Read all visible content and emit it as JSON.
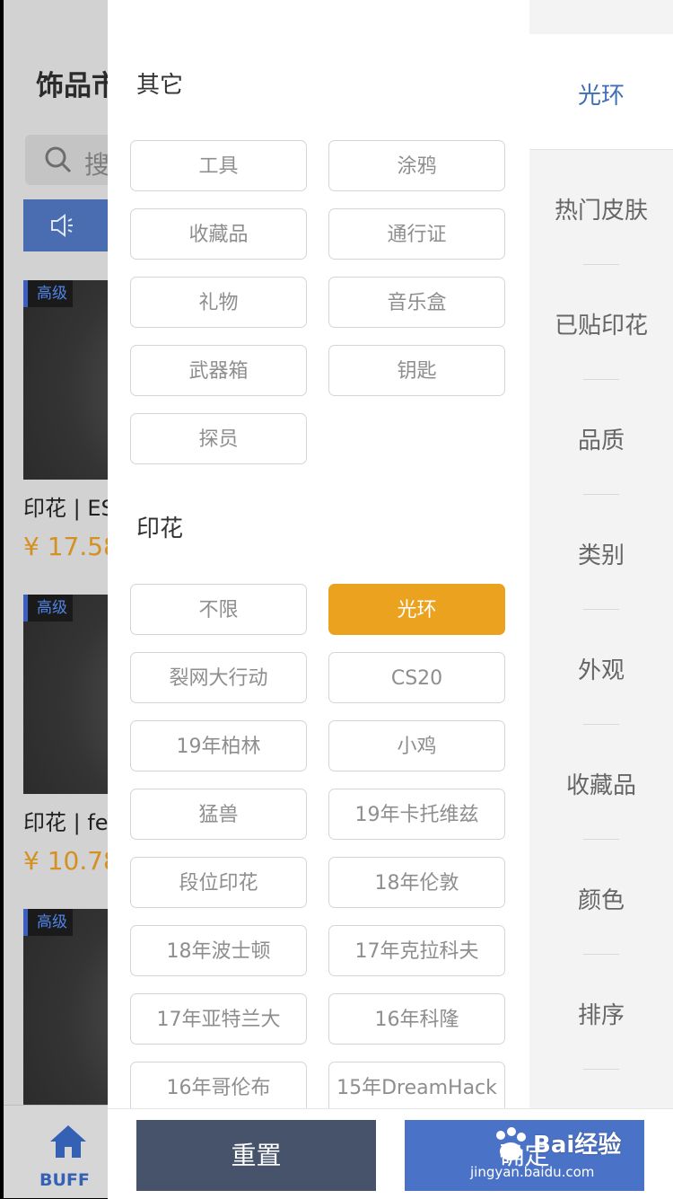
{
  "background": {
    "title": "饰品市",
    "search_placeholder": "搜",
    "cards": [
      {
        "tag": "高级",
        "name": "印花 | ES",
        "price": "¥ 17.58"
      },
      {
        "tag": "高级",
        "name": "印花 | fe",
        "price": "¥ 10.78"
      },
      {
        "tag": "高级"
      }
    ],
    "bottom_nav": {
      "home_label": "BUFF"
    }
  },
  "filter": {
    "sections": [
      {
        "title": "其它",
        "chips": [
          "工具",
          "涂鸦",
          "收藏品",
          "通行证",
          "礼物",
          "音乐盒",
          "武器箱",
          "钥匙",
          "探员"
        ]
      },
      {
        "title": "印花",
        "chips": [
          "不限",
          "光环",
          "裂网大行动",
          "CS20",
          "19年柏林",
          "小鸡",
          "猛兽",
          "19年卡托维兹",
          "段位印花",
          "18年伦敦",
          "18年波士顿",
          "17年克拉科夫",
          "17年亚特兰大",
          "16年科隆",
          "16年哥伦布",
          "15年DreamHack"
        ],
        "selected": "光环"
      }
    ],
    "sidebar": [
      "光环",
      "热门皮肤",
      "已贴印花",
      "品质",
      "类别",
      "外观",
      "收藏品",
      "颜色",
      "排序"
    ],
    "sidebar_active": "光环",
    "reset_label": "重置",
    "confirm_label": "确定"
  },
  "watermark": {
    "text": "Bai经验",
    "url": "jingyan.baidu.com"
  },
  "colors": {
    "accent": "#eaa21f",
    "active_blue": "#3e6fb5",
    "reset_bg": "#47536a",
    "confirm_bg": "#4a73c7"
  }
}
